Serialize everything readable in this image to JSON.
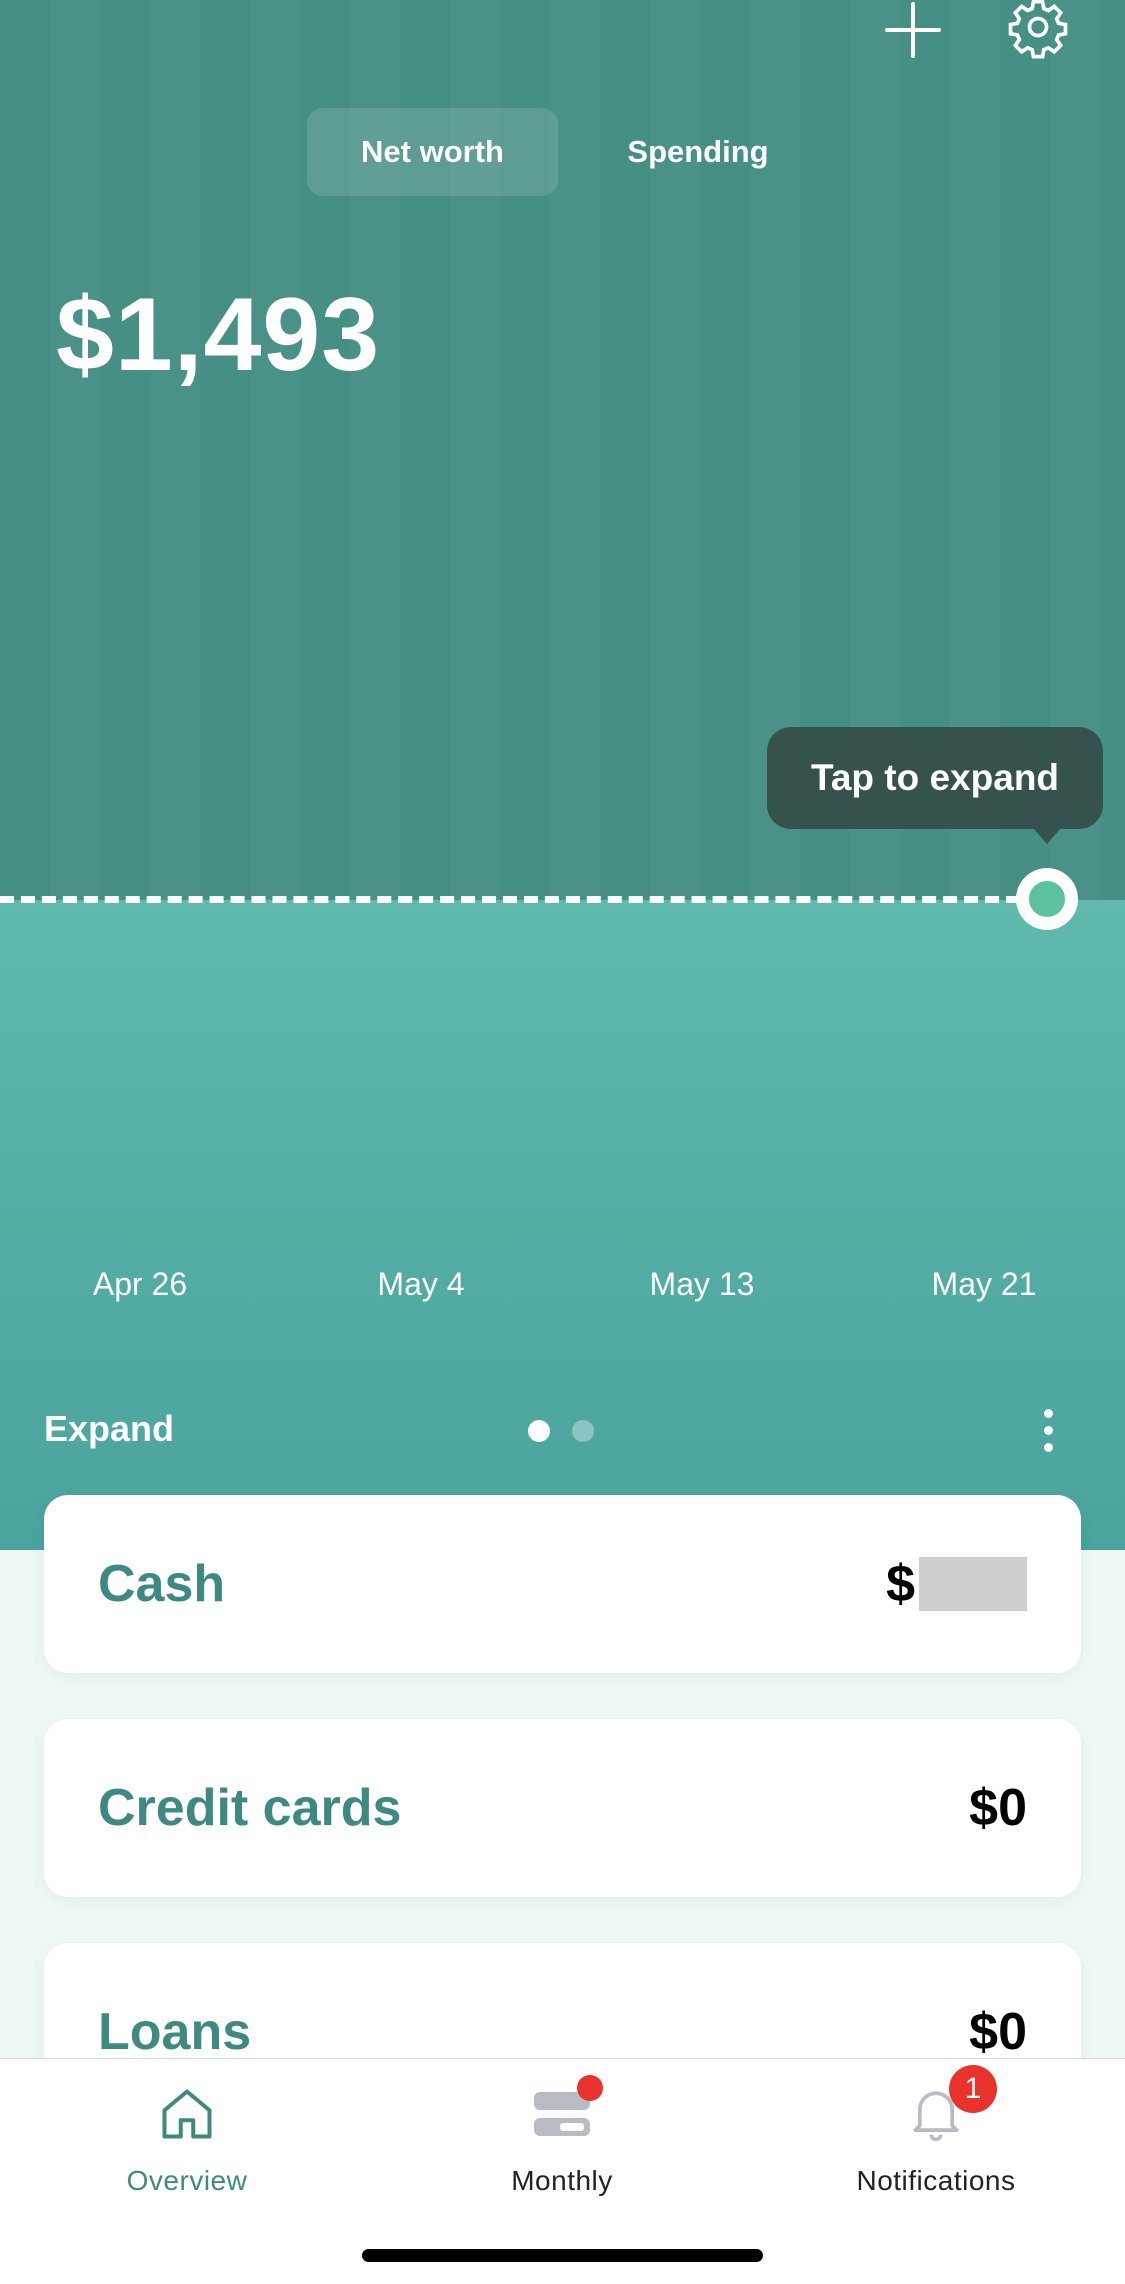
{
  "header": {
    "add_icon": "plus-icon",
    "settings_icon": "gear-icon"
  },
  "segments": [
    {
      "label": "Net worth",
      "active": true
    },
    {
      "label": "Spending",
      "active": false
    }
  ],
  "net_worth_amount": "$1,493",
  "tooltip": {
    "text": "Tap to expand"
  },
  "timeline": {
    "labels": [
      "Apr 26",
      "May 4",
      "May 13",
      "May 21"
    ]
  },
  "expand": {
    "label": "Expand",
    "page_count": 2,
    "current_page": 1,
    "more_icon": "kebab-menu-icon"
  },
  "accounts": [
    {
      "label": "Cash",
      "value": "$",
      "masked": true
    },
    {
      "label": "Credit cards",
      "value": "$0"
    },
    {
      "label": "Loans",
      "value": "$0"
    }
  ],
  "tabbar": {
    "tabs": [
      {
        "label": "Overview",
        "icon": "home-icon",
        "active": true
      },
      {
        "label": "Monthly",
        "icon": "monthly-icon",
        "active": false,
        "dot_badge": true
      },
      {
        "label": "Notifications",
        "icon": "bell-icon",
        "active": false,
        "badge_count": "1"
      }
    ]
  },
  "colors": {
    "header_bg": "#468f85",
    "chart_area": "#5fb9ac",
    "accent": "#3e8a82",
    "badge": "#e8322b",
    "tooltip_bg": "#35524e"
  }
}
